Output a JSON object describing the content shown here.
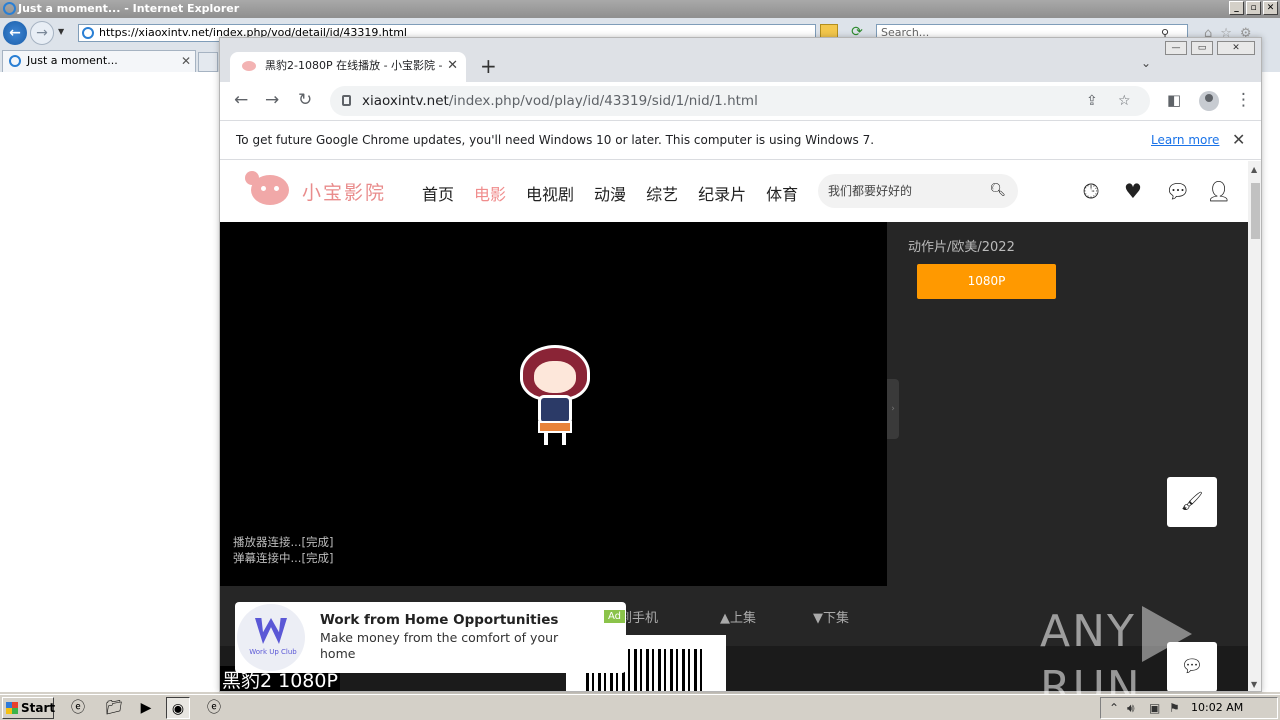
{
  "ie": {
    "title": "Just a moment... - Internet Explorer",
    "address": "https://xiaoxintv.net/index.php/vod/detail/id/43319.html",
    "search_placeholder": "Search...",
    "tab_label": "Just a moment..."
  },
  "chrome": {
    "tab_title": "黑豹2-1080P 在线播放 - 小宝影院 -",
    "url_host": "xiaoxintv.net",
    "url_path": "/index.php/vod/play/id/43319/sid/1/nid/1.html",
    "infobar_text": "To get future Google Chrome updates, you'll need Windows 10 or later. This computer is using Windows 7.",
    "infobar_link": "Learn more"
  },
  "site": {
    "name": "小宝影院",
    "nav": [
      "首页",
      "电影",
      "电视剧",
      "动漫",
      "综艺",
      "纪录片",
      "体育"
    ],
    "active_nav": "电影",
    "search_placeholder": "我们都要好好的",
    "player_log": [
      "播放器连接...[完成]",
      "弹幕连接中...[完成]"
    ],
    "controls": {
      "send_phone": "发送到手机",
      "prev": "▲上集",
      "next": "▼下集"
    },
    "meta": "动作片/欧美/2022",
    "episode_btn": "1080P",
    "video_title": "黑豹2 1080P"
  },
  "ad": {
    "title": "Work from Home Opportunities",
    "body": "Make money from the comfort of your home",
    "badge": "Ad",
    "logo_text": "Work Up Club"
  },
  "watermark": {
    "left": "ANY",
    "right": "RUN"
  },
  "taskbar": {
    "start": "Start",
    "clock": "10:02 AM"
  }
}
